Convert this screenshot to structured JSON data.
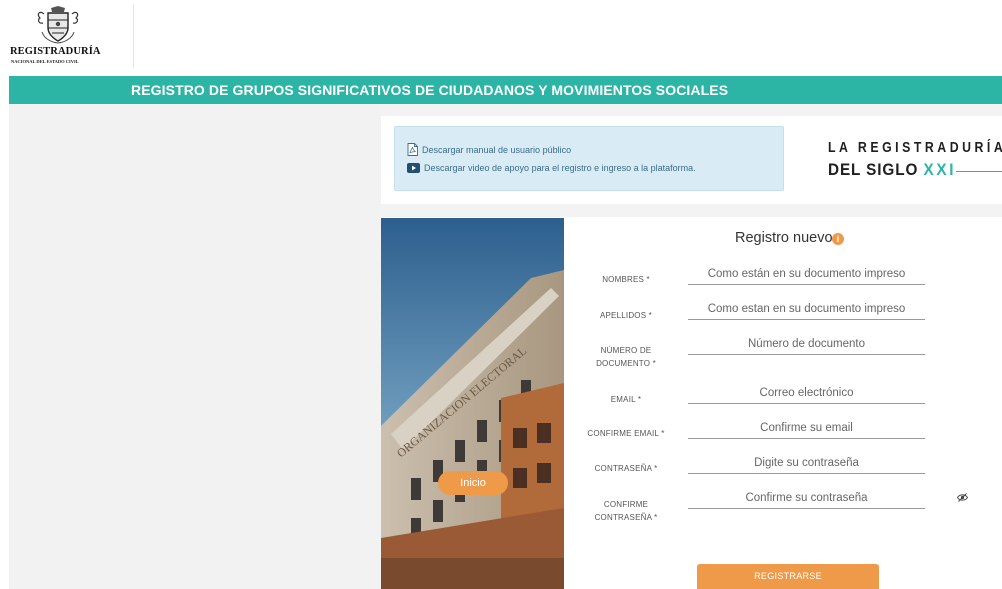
{
  "header": {
    "logo_name": "REGISTRADURÍA",
    "logo_subtitle": "NACIONAL DEL ESTADO CIVIL",
    "page_title": "REGISTRO DE GRUPOS SIGNIFICATIVOS DE CIUDADANOS Y MOVIMIENTOS SOCIALES"
  },
  "downloads": {
    "manual_label": "Descargar manual de usuario público",
    "video_label": "Descargar video de apoyo para el registro e ingreso a la plataforma.",
    "manual_icon": "pdf-icon",
    "video_icon": "video-play-icon"
  },
  "brand": {
    "line1": "LA REGISTRADURÍA",
    "line2_prefix": "DEL SIGLO ",
    "line2_accent": "XXI"
  },
  "photo": {
    "inicio_label": "Inicio"
  },
  "form": {
    "title": "Registro nuevo",
    "info_icon_glyph": "i",
    "fields": [
      {
        "label": "NOMBRES *",
        "placeholder": "Como están en su documento impreso"
      },
      {
        "label": "APELLIDOS *",
        "placeholder": "Como estan en su documento impreso"
      },
      {
        "label_line1": "NÚMERO DE",
        "label_line2": "DOCUMENTO *",
        "placeholder": "Número de documento"
      },
      {
        "label": "EMAIL *",
        "placeholder": "Correo electrónico"
      },
      {
        "label": "CONFIRME EMAIL *",
        "placeholder": "Confirme su email"
      },
      {
        "label": "CONTRASEÑA *",
        "placeholder": "Digite su contraseña"
      },
      {
        "label_line1": "CONFIRME",
        "label_line2": "CONTRASEÑA *",
        "placeholder": "Confirme su contraseña"
      }
    ],
    "submit_label": "REGISTRARSE"
  },
  "colors": {
    "accent": "#2cb5a5",
    "button": "#ee9a48",
    "info_box": "#d9ebf5"
  }
}
